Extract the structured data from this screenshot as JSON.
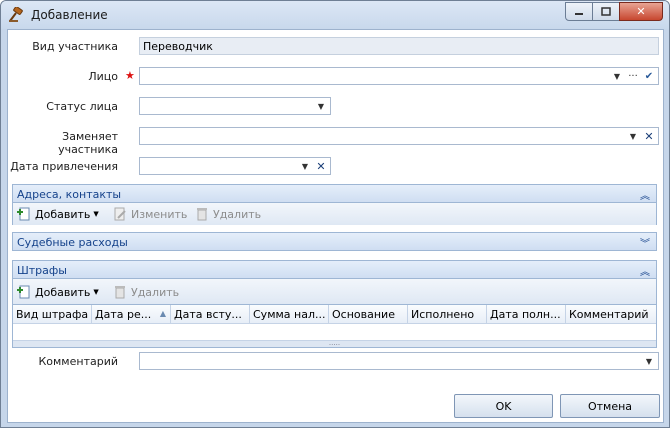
{
  "window": {
    "title": "Добавление",
    "close_glyph": "✕"
  },
  "form": {
    "participant_type_label": "Вид участника",
    "participant_type_value": "Переводчик",
    "person_label": "Лицо",
    "person_value": "",
    "required_mark": "★",
    "person_status_label": "Статус лица",
    "person_status_value": "",
    "replaces_label": "Заменяет участника",
    "replaces_value": "",
    "date_label": "Дата привлечения",
    "date_value": "",
    "comment_label": "Комментарий",
    "comment_value": ""
  },
  "sections": {
    "addresses": {
      "title": "Адреса, контакты",
      "add": "Добавить",
      "edit": "Изменить",
      "delete": "Удалить"
    },
    "court_costs": {
      "title": "Судебные расходы"
    },
    "fines": {
      "title": "Штрафы",
      "add": "Добавить",
      "delete": "Удалить",
      "columns": [
        "Вид штрафа",
        "Дата ре...",
        "Дата всту...",
        "Сумма нал...",
        "Основание",
        "Исполнено",
        "Дата полн...",
        "Комментарий"
      ],
      "footer": "....."
    }
  },
  "buttons": {
    "ok": "OK",
    "cancel": "Отмена"
  },
  "colors": {
    "accent": "#15428b",
    "required": "#dd1111",
    "window_frame": "#c6d6ea"
  }
}
